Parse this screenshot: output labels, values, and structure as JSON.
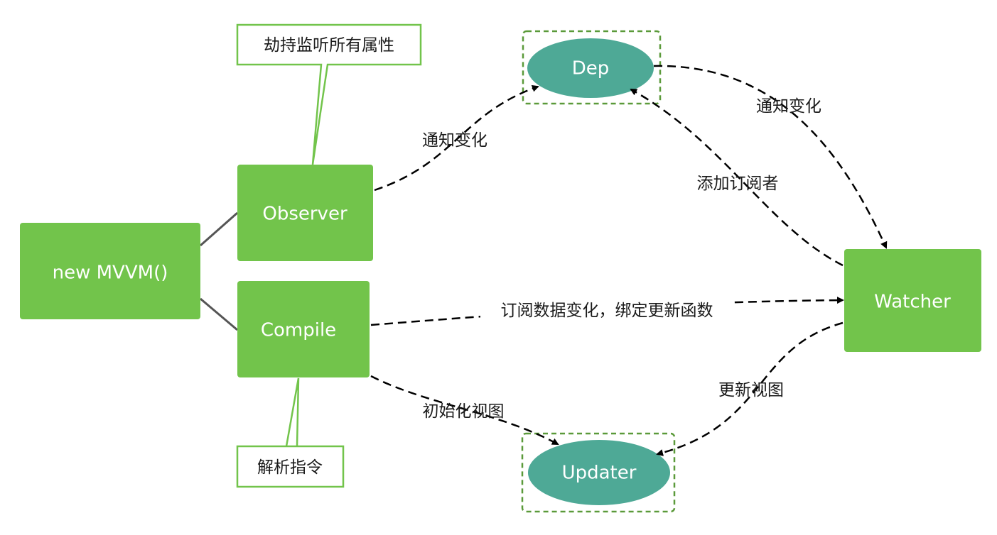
{
  "nodes": {
    "mvvm": "new MVVM()",
    "observer": "Observer",
    "compile": "Compile",
    "dep": "Dep",
    "watcher": "Watcher",
    "updater": "Updater"
  },
  "callouts": {
    "observer": "劫持监听所有属性",
    "compile": "解析指令"
  },
  "edges": {
    "observer_to_dep": "通知变化",
    "dep_to_watcher": "通知变化",
    "watcher_to_dep": "添加订阅者",
    "compile_to_watcher": "订阅数据变化，绑定更新函数",
    "compile_to_updater": "初始化视图",
    "watcher_to_updater": "更新视图"
  },
  "colors": {
    "box_fill": "#72c44b",
    "ellipse_fill": "#4ea996",
    "group_border": "#5b9a3a",
    "callout_border": "#72c44b",
    "connector": "#555555",
    "arrow": "#000000"
  }
}
